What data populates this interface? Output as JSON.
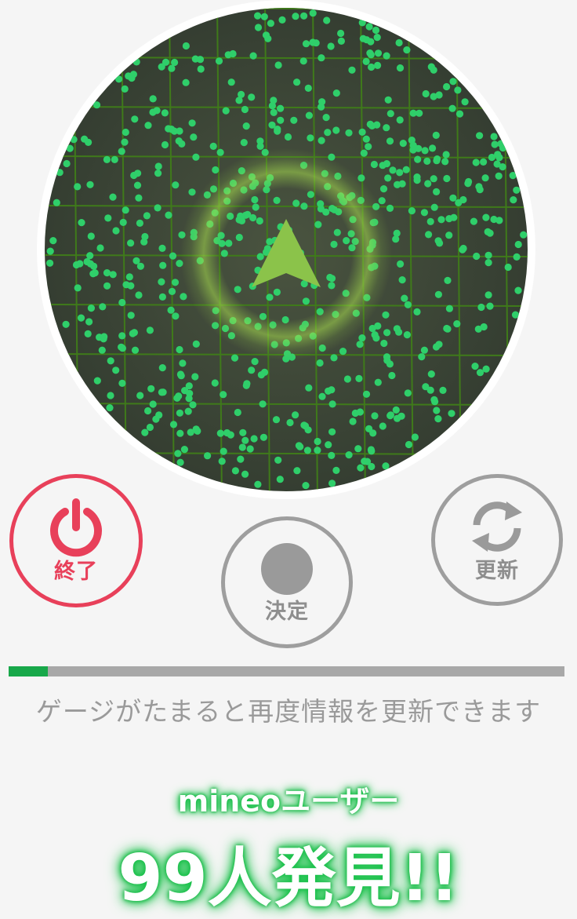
{
  "radar": {
    "user_dot_count": 600,
    "dot_color": "#2fcf6a",
    "grid_color": "#3f7a1a",
    "background_color": "#3f4a3a",
    "rim_color": "#ffffff",
    "arrow_color": "#8bc34a",
    "glow_color": "#9ad64a"
  },
  "controls": {
    "end_label": "終了",
    "decide_label": "決定",
    "refresh_label": "更新",
    "end_color": "#e8405a",
    "disabled_color": "#9e9e9e"
  },
  "gauge": {
    "progress": 0.07,
    "fill_color": "#18a84a",
    "track_color": "#a8a8a8",
    "hint": "ゲージがたまると再度情報を更新できます"
  },
  "result": {
    "label": "mineoユーザー",
    "count_text": "99人発見!!"
  }
}
